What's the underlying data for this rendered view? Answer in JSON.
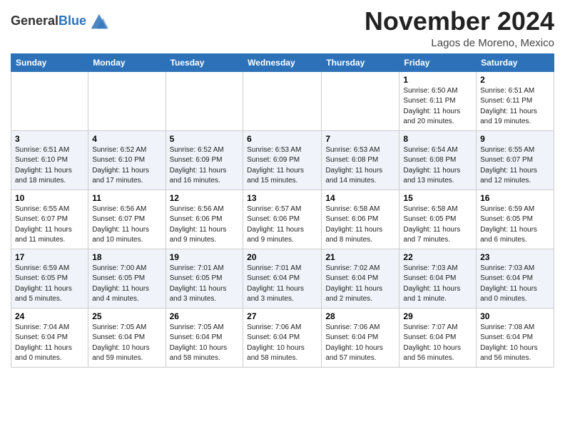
{
  "header": {
    "logo_line1": "General",
    "logo_line2": "Blue",
    "month": "November 2024",
    "location": "Lagos de Moreno, Mexico"
  },
  "weekdays": [
    "Sunday",
    "Monday",
    "Tuesday",
    "Wednesday",
    "Thursday",
    "Friday",
    "Saturday"
  ],
  "rows": [
    [
      {
        "day": "",
        "info": ""
      },
      {
        "day": "",
        "info": ""
      },
      {
        "day": "",
        "info": ""
      },
      {
        "day": "",
        "info": ""
      },
      {
        "day": "",
        "info": ""
      },
      {
        "day": "1",
        "info": "Sunrise: 6:50 AM\nSunset: 6:11 PM\nDaylight: 11 hours\nand 20 minutes."
      },
      {
        "day": "2",
        "info": "Sunrise: 6:51 AM\nSunset: 6:11 PM\nDaylight: 11 hours\nand 19 minutes."
      }
    ],
    [
      {
        "day": "3",
        "info": "Sunrise: 6:51 AM\nSunset: 6:10 PM\nDaylight: 11 hours\nand 18 minutes."
      },
      {
        "day": "4",
        "info": "Sunrise: 6:52 AM\nSunset: 6:10 PM\nDaylight: 11 hours\nand 17 minutes."
      },
      {
        "day": "5",
        "info": "Sunrise: 6:52 AM\nSunset: 6:09 PM\nDaylight: 11 hours\nand 16 minutes."
      },
      {
        "day": "6",
        "info": "Sunrise: 6:53 AM\nSunset: 6:09 PM\nDaylight: 11 hours\nand 15 minutes."
      },
      {
        "day": "7",
        "info": "Sunrise: 6:53 AM\nSunset: 6:08 PM\nDaylight: 11 hours\nand 14 minutes."
      },
      {
        "day": "8",
        "info": "Sunrise: 6:54 AM\nSunset: 6:08 PM\nDaylight: 11 hours\nand 13 minutes."
      },
      {
        "day": "9",
        "info": "Sunrise: 6:55 AM\nSunset: 6:07 PM\nDaylight: 11 hours\nand 12 minutes."
      }
    ],
    [
      {
        "day": "10",
        "info": "Sunrise: 6:55 AM\nSunset: 6:07 PM\nDaylight: 11 hours\nand 11 minutes."
      },
      {
        "day": "11",
        "info": "Sunrise: 6:56 AM\nSunset: 6:07 PM\nDaylight: 11 hours\nand 10 minutes."
      },
      {
        "day": "12",
        "info": "Sunrise: 6:56 AM\nSunset: 6:06 PM\nDaylight: 11 hours\nand 9 minutes."
      },
      {
        "day": "13",
        "info": "Sunrise: 6:57 AM\nSunset: 6:06 PM\nDaylight: 11 hours\nand 9 minutes."
      },
      {
        "day": "14",
        "info": "Sunrise: 6:58 AM\nSunset: 6:06 PM\nDaylight: 11 hours\nand 8 minutes."
      },
      {
        "day": "15",
        "info": "Sunrise: 6:58 AM\nSunset: 6:05 PM\nDaylight: 11 hours\nand 7 minutes."
      },
      {
        "day": "16",
        "info": "Sunrise: 6:59 AM\nSunset: 6:05 PM\nDaylight: 11 hours\nand 6 minutes."
      }
    ],
    [
      {
        "day": "17",
        "info": "Sunrise: 6:59 AM\nSunset: 6:05 PM\nDaylight: 11 hours\nand 5 minutes."
      },
      {
        "day": "18",
        "info": "Sunrise: 7:00 AM\nSunset: 6:05 PM\nDaylight: 11 hours\nand 4 minutes."
      },
      {
        "day": "19",
        "info": "Sunrise: 7:01 AM\nSunset: 6:05 PM\nDaylight: 11 hours\nand 3 minutes."
      },
      {
        "day": "20",
        "info": "Sunrise: 7:01 AM\nSunset: 6:04 PM\nDaylight: 11 hours\nand 3 minutes."
      },
      {
        "day": "21",
        "info": "Sunrise: 7:02 AM\nSunset: 6:04 PM\nDaylight: 11 hours\nand 2 minutes."
      },
      {
        "day": "22",
        "info": "Sunrise: 7:03 AM\nSunset: 6:04 PM\nDaylight: 11 hours\nand 1 minute."
      },
      {
        "day": "23",
        "info": "Sunrise: 7:03 AM\nSunset: 6:04 PM\nDaylight: 11 hours\nand 0 minutes."
      }
    ],
    [
      {
        "day": "24",
        "info": "Sunrise: 7:04 AM\nSunset: 6:04 PM\nDaylight: 11 hours\nand 0 minutes."
      },
      {
        "day": "25",
        "info": "Sunrise: 7:05 AM\nSunset: 6:04 PM\nDaylight: 10 hours\nand 59 minutes."
      },
      {
        "day": "26",
        "info": "Sunrise: 7:05 AM\nSunset: 6:04 PM\nDaylight: 10 hours\nand 58 minutes."
      },
      {
        "day": "27",
        "info": "Sunrise: 7:06 AM\nSunset: 6:04 PM\nDaylight: 10 hours\nand 58 minutes."
      },
      {
        "day": "28",
        "info": "Sunrise: 7:06 AM\nSunset: 6:04 PM\nDaylight: 10 hours\nand 57 minutes."
      },
      {
        "day": "29",
        "info": "Sunrise: 7:07 AM\nSunset: 6:04 PM\nDaylight: 10 hours\nand 56 minutes."
      },
      {
        "day": "30",
        "info": "Sunrise: 7:08 AM\nSunset: 6:04 PM\nDaylight: 10 hours\nand 56 minutes."
      }
    ]
  ]
}
